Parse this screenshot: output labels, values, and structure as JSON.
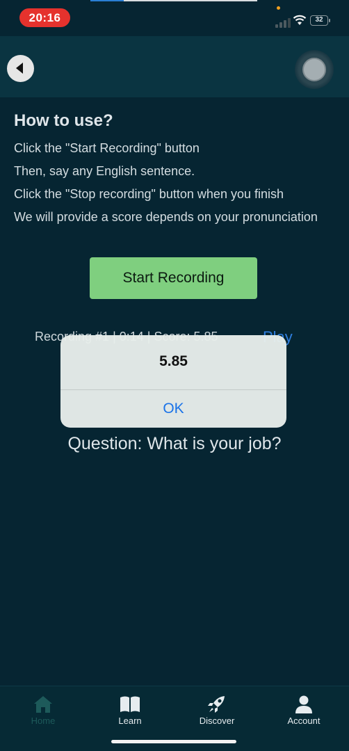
{
  "status_bar": {
    "time": "20:16",
    "battery": "32"
  },
  "instructions": {
    "title": "How to use?",
    "lines": [
      "Click the \"Start Recording\" button",
      "Then, say any English sentence.",
      "Click the \"Stop recording\" button when you finish",
      "We will provide a score depends on your pronunciation"
    ]
  },
  "start_button_label": "Start Recording",
  "recording": {
    "text": "Recording #1 | 0:14 | Score: 5.85",
    "play_label": "Play"
  },
  "question": "Question: What is your job?",
  "alert": {
    "title": "5.85",
    "ok_label": "OK"
  },
  "tabs": [
    {
      "label": "Home",
      "icon": "home-icon",
      "active": true
    },
    {
      "label": "Learn",
      "icon": "book-icon",
      "active": false
    },
    {
      "label": "Discover",
      "icon": "rocket-icon",
      "active": false
    },
    {
      "label": "Account",
      "icon": "user-icon",
      "active": false
    }
  ],
  "colors": {
    "background": "#062532",
    "header": "#0a3441",
    "start_button": "#7fcf7f",
    "link": "#2f7fe0",
    "time_pill": "#e5322d",
    "active_tab": "#1d5a5a"
  }
}
